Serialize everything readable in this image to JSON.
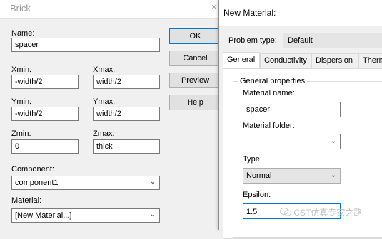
{
  "brick": {
    "title": "Brick",
    "close_glyph": "×",
    "name_label": "Name:",
    "name_value": "spacer",
    "xmin_label": "Xmin:",
    "xmin_value": "-width/2",
    "xmax_label": "Xmax:",
    "xmax_value": "width/2",
    "ymin_label": "Ymin:",
    "ymin_value": "-width/2",
    "ymax_label": "Ymax:",
    "ymax_value": "width/2",
    "zmin_label": "Zmin:",
    "zmin_value": "0",
    "zmax_label": "Zmax:",
    "zmax_value": "thick",
    "component_label": "Component:",
    "component_value": "component1",
    "material_label": "Material:",
    "material_value": "[New Material...]",
    "buttons": {
      "ok": "OK",
      "cancel": "Cancel",
      "preview": "Preview",
      "help": "Help"
    }
  },
  "new_material": {
    "title": "New Material:",
    "problem_type_label": "Problem type:",
    "problem_type_value": "Default",
    "tabs": [
      "General",
      "Conductivity",
      "Dispersion",
      "Therm"
    ],
    "active_tab": "General",
    "group_label": "General properties",
    "material_name_label": "Material name:",
    "material_name_value": "spacer",
    "material_folder_label": "Material folder:",
    "material_folder_value": "",
    "type_label": "Type:",
    "type_value": "Normal",
    "epsilon_label": "Epsilon:",
    "epsilon_value": "1.5"
  },
  "watermark": {
    "text": "CST仿真专家之路",
    "icon": "wechat-icon"
  },
  "icons": {
    "dropdown": "chevron-down-icon"
  },
  "colors": {
    "focus_border": "#0078d7",
    "title_text": "#999999"
  }
}
